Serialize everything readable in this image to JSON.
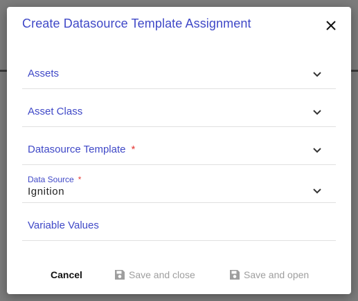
{
  "dialog": {
    "title": "Create Datasource Template Assignment"
  },
  "fields": {
    "assets": {
      "label": "Assets"
    },
    "asset_class": {
      "label": "Asset Class"
    },
    "datasource_template": {
      "label": "Datasource Template",
      "required_marker": "*"
    },
    "data_source": {
      "label": "Data Source",
      "required_marker": "*",
      "value": "Ignition"
    },
    "variable_values": {
      "label": "Variable Values"
    }
  },
  "actions": {
    "cancel": "Cancel",
    "save_and_close": "Save and close",
    "save_and_open": "Save and open"
  },
  "colors": {
    "accent": "#3f48c7",
    "required": "#e53935",
    "disabled": "#9e9e9e",
    "text": "#222222"
  },
  "icons": {
    "close": "close-icon",
    "chevron": "chevron-down-icon",
    "save": "save-icon"
  }
}
